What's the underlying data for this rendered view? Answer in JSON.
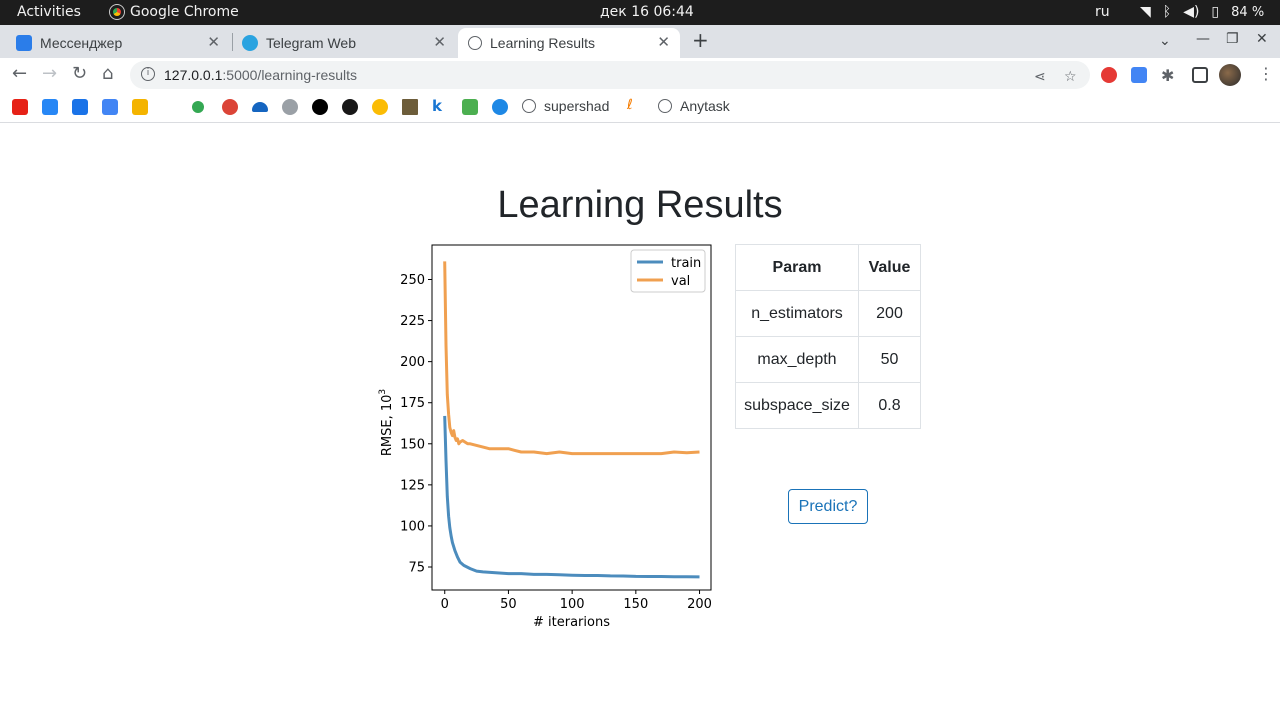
{
  "topbar": {
    "activities": "Activities",
    "app_name": "Google Chrome",
    "clock": "дек 16  06:44",
    "lang": "ru",
    "battery": "84 %"
  },
  "tabs": [
    {
      "label": "Мессенджер",
      "icon": "messenger-icon",
      "color": "#2b7de9"
    },
    {
      "label": "Telegram Web",
      "icon": "telegram-icon",
      "color": "#2aa3e0"
    },
    {
      "label": "Learning Results",
      "icon": "globe-icon",
      "color": "#5f6368",
      "active": true
    }
  ],
  "address_bar": {
    "host": "127.0.0.1",
    "path": ":5000/learning-results"
  },
  "bookmarks": {
    "supershad": "supershad",
    "anytask": "Anytask"
  },
  "page": {
    "title": "Learning Results",
    "predict_button": "Predict?"
  },
  "params_table": {
    "headers": [
      "Param",
      "Value"
    ],
    "rows": [
      [
        "n_estimators",
        "200"
      ],
      [
        "max_depth",
        "50"
      ],
      [
        "subspace_size",
        "0.8"
      ]
    ]
  },
  "chart_data": {
    "type": "line",
    "xlabel": "# iterarions",
    "ylabel": "RMSE, 10",
    "ylabel_sup": "3",
    "xlim": [
      -10,
      209
    ],
    "ylim": [
      61,
      271
    ],
    "xticks": [
      0,
      50,
      100,
      150,
      200
    ],
    "yticks": [
      75,
      100,
      125,
      150,
      175,
      200,
      225,
      250
    ],
    "legend": "top-right",
    "series": [
      {
        "name": "train",
        "color": "#4c8cbd",
        "x": [
          0,
          1,
          2,
          3,
          4,
          5,
          6,
          8,
          10,
          12,
          15,
          20,
          25,
          30,
          40,
          50,
          60,
          70,
          80,
          90,
          100,
          110,
          120,
          130,
          140,
          150,
          160,
          170,
          180,
          190,
          200
        ],
        "y": [
          167,
          140,
          118,
          106,
          99,
          94,
          90,
          85,
          81,
          78,
          76,
          74,
          72.5,
          72,
          71.5,
          71,
          71,
          70.5,
          70.5,
          70.3,
          70,
          69.8,
          69.8,
          69.6,
          69.5,
          69.3,
          69.2,
          69.2,
          69.1,
          69.1,
          69
        ]
      },
      {
        "name": "val",
        "color": "#f0a050",
        "x": [
          0,
          1,
          2,
          3,
          4,
          5,
          6,
          7,
          8,
          9,
          10,
          11,
          12,
          14,
          16,
          18,
          20,
          25,
          30,
          35,
          40,
          50,
          55,
          60,
          70,
          80,
          90,
          100,
          110,
          120,
          130,
          140,
          150,
          160,
          170,
          180,
          190,
          200
        ],
        "y": [
          261,
          210,
          180,
          168,
          160,
          157,
          155,
          158,
          154,
          152,
          153,
          150,
          151,
          152,
          151,
          150,
          150,
          149,
          148,
          147,
          147,
          147,
          146,
          145,
          145,
          144,
          145,
          144,
          144,
          144,
          144,
          144,
          144,
          144,
          144,
          145,
          144.5,
          145
        ]
      }
    ]
  }
}
